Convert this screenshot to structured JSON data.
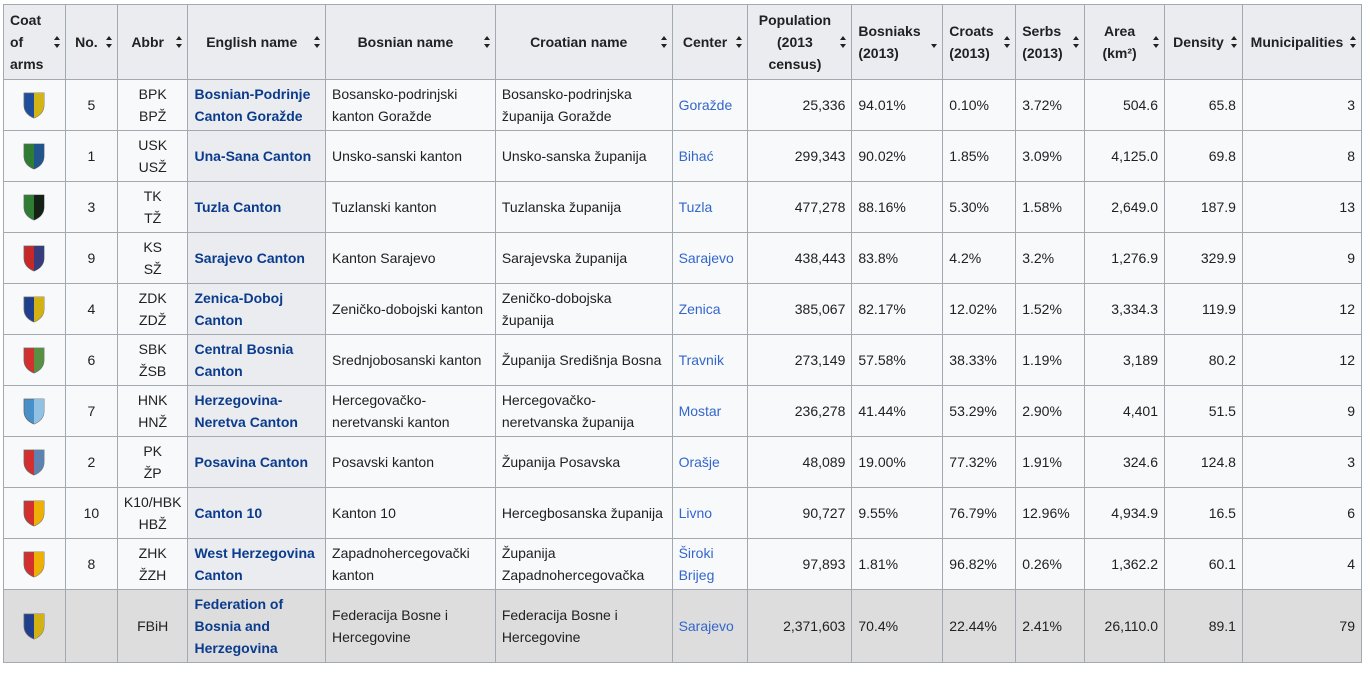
{
  "headers": [
    {
      "label": "Coat of arms"
    },
    {
      "label": "No."
    },
    {
      "label": "Abbr"
    },
    {
      "label": "English name"
    },
    {
      "label": "Bosnian name"
    },
    {
      "label": "Croatian name"
    },
    {
      "label": "Center"
    },
    {
      "label": "Population (2013 census)"
    },
    {
      "label": "Bosniaks (2013)"
    },
    {
      "label": "Croats (2013)"
    },
    {
      "label": "Serbs (2013)"
    },
    {
      "label": "Area (km²)"
    },
    {
      "label": "Density"
    },
    {
      "label": "Municipalities"
    }
  ],
  "rows": [
    {
      "no": "5",
      "abbr1": "BPK",
      "abbr2": "BPŽ",
      "english": "Bosnian-Podrinje Canton Goražde",
      "bosnian": "Bosansko-podrinjski kanton Goražde",
      "croatian": "Bosansko-podrinjska županija Goražde",
      "center": "Goražde",
      "population": "25,336",
      "bosniaks": "94.01%",
      "croats": "0.10%",
      "serbs": "3.72%",
      "area": "504.6",
      "density": "65.8",
      "municipalities": "3",
      "coa_colors": [
        "#1f4f9c",
        "#f2c500"
      ]
    },
    {
      "no": "1",
      "abbr1": "USK",
      "abbr2": "USŽ",
      "english": "Una-Sana Canton",
      "bosnian": "Unsko-sanski kanton",
      "croatian": "Unsko-sanska županija",
      "center": "Bihać",
      "population": "299,343",
      "bosniaks": "90.02%",
      "croats": "1.85%",
      "serbs": "3.09%",
      "area": "4,125.0",
      "density": "69.8",
      "municipalities": "8",
      "coa_colors": [
        "#2e7d32",
        "#1f4f9c"
      ]
    },
    {
      "no": "3",
      "abbr1": "TK",
      "abbr2": "TŽ",
      "english": "Tuzla Canton",
      "bosnian": "Tuzlanski kanton",
      "croatian": "Tuzlanska županija",
      "center": "Tuzla",
      "population": "477,278",
      "bosniaks": "88.16%",
      "croats": "5.30%",
      "serbs": "1.58%",
      "area": "2,649.0",
      "density": "187.9",
      "municipalities": "13",
      "coa_colors": [
        "#2e7d32",
        "#111111"
      ]
    },
    {
      "no": "9",
      "abbr1": "KS",
      "abbr2": "SŽ",
      "english": "Sarajevo Canton",
      "bosnian": "Kanton Sarajevo",
      "croatian": "Sarajevska županija",
      "center": "Sarajevo",
      "population": "438,443",
      "bosniaks": "83.8%",
      "croats": "4.2%",
      "serbs": "3.2%",
      "area": "1,276.9",
      "density": "329.9",
      "municipalities": "9",
      "coa_colors": [
        "#c62828",
        "#1f3f8c"
      ]
    },
    {
      "no": "4",
      "abbr1": "ZDK",
      "abbr2": "ZDŽ",
      "english": "Zenica-Doboj Canton",
      "bosnian": "Zeničko-dobojski kanton",
      "croatian": "Zeničko-dobojska županija",
      "center": "Zenica",
      "population": "385,067",
      "bosniaks": "82.17%",
      "croats": "12.02%",
      "serbs": "1.52%",
      "area": "3,334.3",
      "density": "119.9",
      "municipalities": "12",
      "coa_colors": [
        "#1f3f8c",
        "#f2c500"
      ]
    },
    {
      "no": "6",
      "abbr1": "SBK",
      "abbr2": "ŽSB",
      "english": "Central Bosnia Canton",
      "bosnian": "Srednjobosanski kanton",
      "croatian": "Županija Središnja Bosna",
      "center": "Travnik",
      "population": "273,149",
      "bosniaks": "57.58%",
      "croats": "38.33%",
      "serbs": "1.19%",
      "area": "3,189",
      "density": "80.2",
      "municipalities": "12",
      "coa_colors": [
        "#d32f2f",
        "#43a047"
      ]
    },
    {
      "no": "7",
      "abbr1": "HNK",
      "abbr2": "HNŽ",
      "english": "Herzegovina-Neretva Canton",
      "bosnian": "Hercegovačko-neretvanski kanton",
      "croatian": "Hercegovačko-neretvanska županija",
      "center": "Mostar",
      "population": "236,278",
      "bosniaks": "41.44%",
      "croats": "53.29%",
      "serbs": "2.90%",
      "area": "4,401",
      "density": "51.5",
      "municipalities": "9",
      "coa_colors": [
        "#4a90c8",
        "#9ecae8"
      ]
    },
    {
      "no": "2",
      "abbr1": "PK",
      "abbr2": "ŽP",
      "english": "Posavina Canton",
      "bosnian": "Posavski kanton",
      "croatian": "Županija Posavska",
      "center": "Orašje",
      "population": "48,089",
      "bosniaks": "19.00%",
      "croats": "77.32%",
      "serbs": "1.91%",
      "area": "324.6",
      "density": "124.8",
      "municipalities": "3",
      "coa_colors": [
        "#d32f2f",
        "#4a90c8"
      ]
    },
    {
      "no": "10",
      "abbr1": "K10/HBK",
      "abbr2": "HBŽ",
      "english": "Canton 10",
      "bosnian": "Kanton 10",
      "croatian": "Hercegbosanska županija",
      "center": "Livno",
      "population": "90,727",
      "bosniaks": "9.55%",
      "croats": "76.79%",
      "serbs": "12.96%",
      "area": "4,934.9",
      "density": "16.5",
      "municipalities": "6",
      "coa_colors": [
        "#d32f2f",
        "#f2c500"
      ]
    },
    {
      "no": "8",
      "abbr1": "ZHK",
      "abbr2": "ŽZH",
      "english": "West Herzegovina Canton",
      "bosnian": "Zapadnohercegovački kanton",
      "croatian": "Županija Zapadnohercegovačka",
      "center": "Široki Brijeg",
      "population": "97,893",
      "bosniaks": "1.81%",
      "croats": "96.82%",
      "serbs": "0.26%",
      "area": "1,362.2",
      "density": "60.1",
      "municipalities": "4",
      "coa_colors": [
        "#d32f2f",
        "#f2c500"
      ]
    }
  ],
  "total": {
    "no": "",
    "abbr1": "FBiH",
    "abbr2": "",
    "english": "Federation of Bosnia and Herzegovina",
    "bosnian": "Federacija Bosne i Hercegovine",
    "croatian": "Federacija Bosne i Hercegovine",
    "center": "Sarajevo",
    "population": "2,371,603",
    "bosniaks": "70.4%",
    "croats": "22.44%",
    "serbs": "2.41%",
    "area": "26,110.0",
    "density": "89.1",
    "municipalities": "79",
    "coa_colors": [
      "#1f3f8c",
      "#f2c500"
    ]
  },
  "sorted_column": "Bosniaks (2013)"
}
